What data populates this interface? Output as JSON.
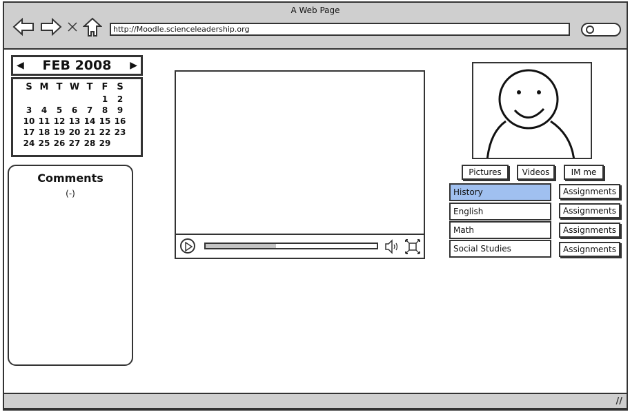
{
  "browser": {
    "title": "A Web Page",
    "url": "http://Moodle.scienceleadership.org",
    "nav_icons": [
      "back-arrow-icon",
      "forward-arrow-icon",
      "close-x-icon",
      "home-icon"
    ],
    "search_icon": "search-icon"
  },
  "calendar": {
    "month_label": "FEB 2008",
    "weekdays": [
      "S",
      "M",
      "T",
      "W",
      "T",
      "F",
      "S"
    ],
    "weeks": [
      [
        "",
        "",
        "",
        "",
        "",
        "1",
        "2"
      ],
      [
        "3",
        "4",
        "5",
        "6",
        "7",
        "8",
        "9"
      ],
      [
        "10",
        "11",
        "12",
        "13",
        "14",
        "15",
        "16"
      ],
      [
        "17",
        "18",
        "19",
        "20",
        "21",
        "22",
        "23"
      ],
      [
        "24",
        "25",
        "26",
        "27",
        "28",
        "29",
        ""
      ]
    ]
  },
  "comments": {
    "title": "Comments",
    "value": "(-)"
  },
  "video": {
    "progress_percent": 41,
    "icons": [
      "play-icon",
      "volume-icon",
      "fullscreen-icon"
    ]
  },
  "profile": {
    "buttons": [
      "Pictures",
      "Videos",
      "IM me"
    ]
  },
  "subjects": [
    {
      "name": "History",
      "selected": true,
      "action": "Assignments"
    },
    {
      "name": "English",
      "selected": false,
      "action": "Assignments"
    },
    {
      "name": "Math",
      "selected": false,
      "action": "Assignments"
    },
    {
      "name": "Social Studies",
      "selected": false,
      "action": "Assignments"
    }
  ],
  "colors": {
    "selected": "#a0c0f0",
    "chrome": "#cfcfcf",
    "progress_fill": "#c4c4c4"
  }
}
